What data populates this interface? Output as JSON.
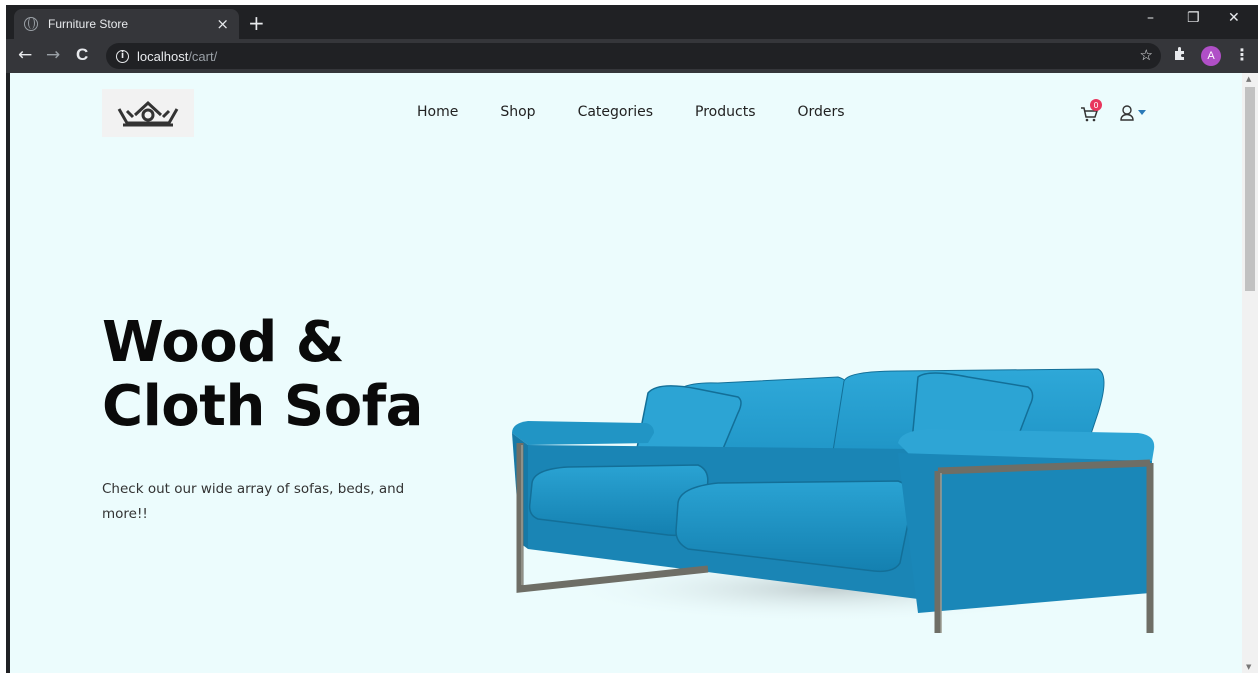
{
  "browser": {
    "tab_title": "Furniture Store",
    "tab_close": "×",
    "new_tab": "+",
    "window_controls": {
      "minimize": "–",
      "restore": "❐",
      "close": "✕"
    },
    "nav": {
      "back": "←",
      "forward": "→",
      "reload": "C"
    },
    "address": {
      "host": "localhost",
      "path": "/cart/"
    },
    "profile_initial": "A"
  },
  "site": {
    "nav_items": [
      "Home",
      "Shop",
      "Categories",
      "Products",
      "Orders"
    ],
    "cart_count": "0"
  },
  "hero": {
    "title_line1": "Wood &",
    "title_line2": "Cloth Sofa",
    "subtitle": "Check out our wide array of sofas, beds, and more!!"
  },
  "colors": {
    "page_bg": "#ecfcfd",
    "sofa_blue": "#1c93c4",
    "badge": "#e8365d",
    "accent_caret": "#2a7ab8"
  }
}
